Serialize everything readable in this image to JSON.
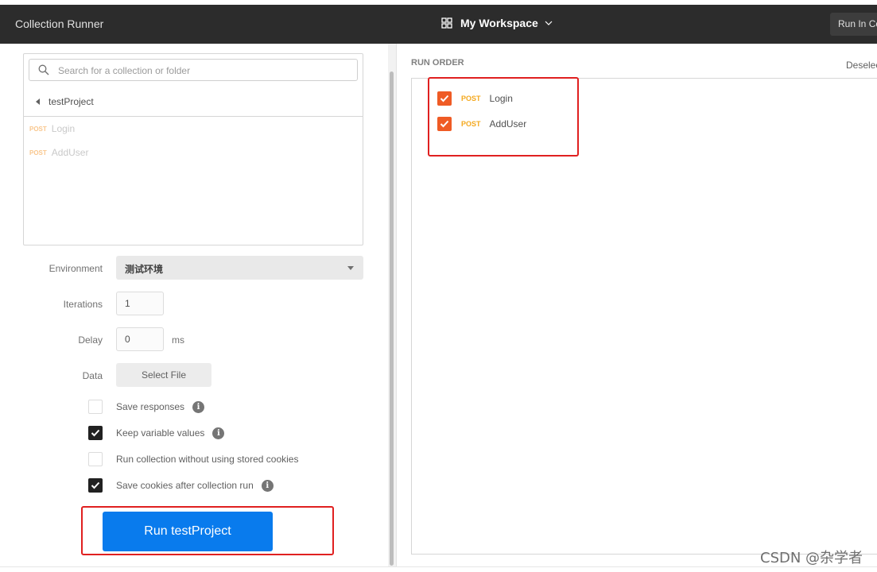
{
  "window": {
    "title": "Collection Runner",
    "workspace": "My Workspace",
    "run_in_label": "Run In Co"
  },
  "collections": {
    "search_placeholder": "Search for a collection or folder",
    "current": "testProject",
    "requests": [
      {
        "method": "POST",
        "name": "Login"
      },
      {
        "method": "POST",
        "name": "AddUser"
      }
    ]
  },
  "settings": {
    "environment_label": "Environment",
    "environment_value": "测试环境",
    "iterations_label": "Iterations",
    "iterations_value": "1",
    "delay_label": "Delay",
    "delay_value": "0",
    "delay_unit": "ms",
    "data_label": "Data",
    "select_file": "Select File"
  },
  "options": [
    {
      "label": "Save responses",
      "checked": false,
      "info": true
    },
    {
      "label": "Keep variable values",
      "checked": true,
      "info": true
    },
    {
      "label": "Run collection without using stored cookies",
      "checked": false,
      "info": false
    },
    {
      "label": "Save cookies after collection run",
      "checked": true,
      "info": true
    }
  ],
  "run_button": "Run testProject",
  "run_order": {
    "title": "RUN ORDER",
    "deselect_label": "Deselect",
    "items": [
      {
        "method": "POST",
        "name": "Login",
        "checked": true
      },
      {
        "method": "POST",
        "name": "AddUser",
        "checked": true
      }
    ]
  },
  "watermark": "CSDN @杂学者",
  "colors": {
    "accent": "#097bed",
    "checkbox_orange": "#ef5b25",
    "post_method": "#f4a81d",
    "highlight_red": "#e02020"
  }
}
